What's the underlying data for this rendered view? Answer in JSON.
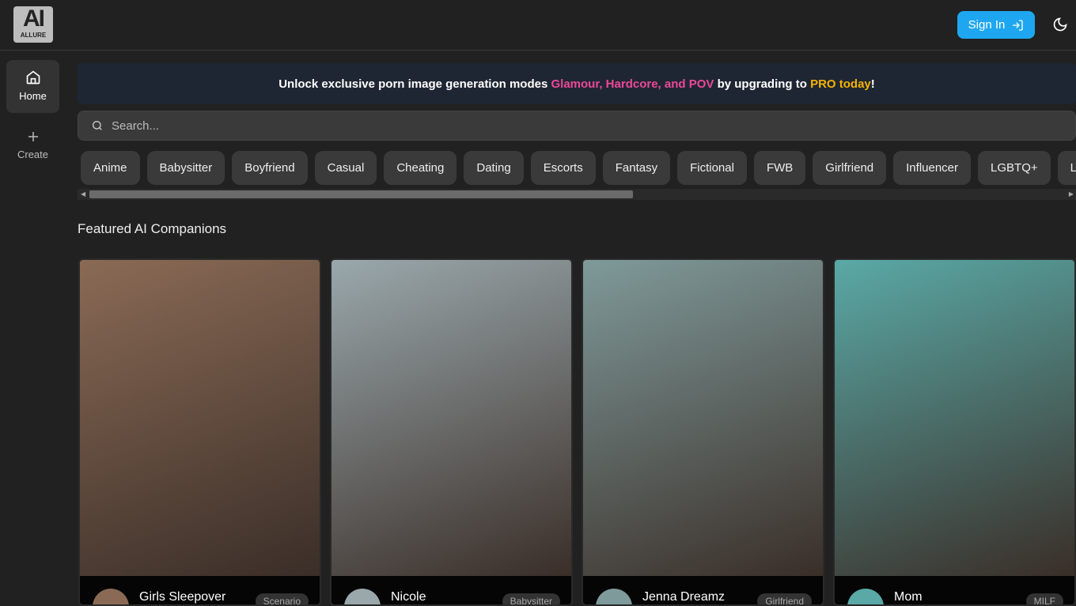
{
  "header": {
    "logo_text": "AI",
    "logo_sub": "ALLURE",
    "sign_in": "Sign In"
  },
  "sidebar": {
    "items": [
      {
        "label": "Home",
        "icon": "home-icon",
        "active": true
      },
      {
        "label": "Create",
        "icon": "plus-icon"
      }
    ]
  },
  "banner": {
    "pre": "Unlock exclusive porn image generation modes ",
    "highlight": "Glamour, Hardcore, and POV",
    "mid": " by upgrading to ",
    "pro": "PRO today",
    "end": "!",
    "colors": {
      "highlight": "#ec4899",
      "pro": "#f5b301"
    }
  },
  "search": {
    "placeholder": "Search..."
  },
  "categories": [
    "Anime",
    "Babysitter",
    "Boyfriend",
    "Casual",
    "Cheating",
    "Dating",
    "Escorts",
    "Fantasy",
    "Fictional",
    "FWB",
    "Girlfriend",
    "Influencer",
    "LGBTQ+",
    "Lo"
  ],
  "section_title": "Featured AI Companions",
  "cards": [
    {
      "name": "Girls Sleepover",
      "badge": "Scenario",
      "tone": "#8a6a55"
    },
    {
      "name": "Nicole",
      "badge": "Babysitter",
      "tone": "#9aa8ac"
    },
    {
      "name": "Jenna Dreamz",
      "badge": "Girlfriend",
      "tone": "#7f9a9a"
    },
    {
      "name": "Mom",
      "badge": "MILF",
      "tone": "#5aa9a6"
    }
  ]
}
